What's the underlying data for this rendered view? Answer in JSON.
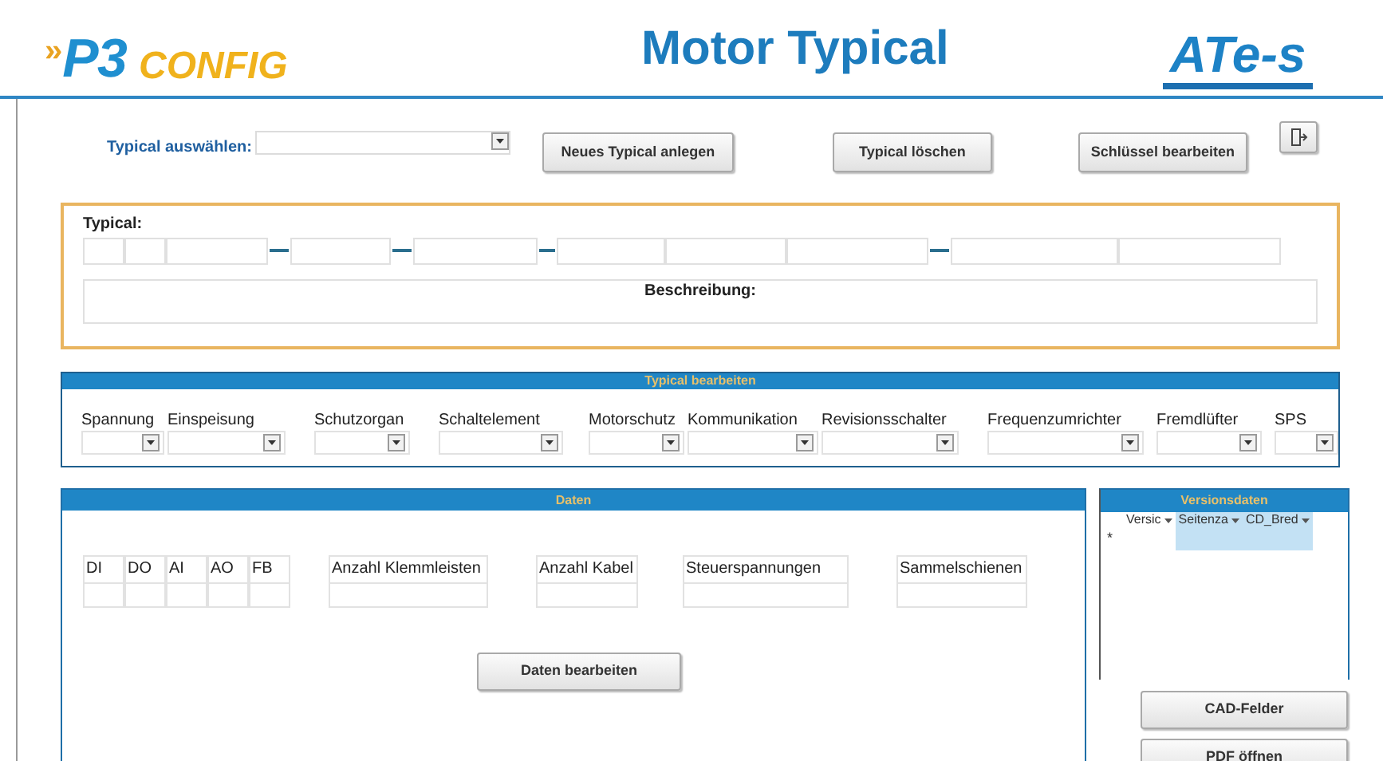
{
  "header": {
    "logo_mark": "»",
    "logo_main": "P3",
    "logo_sub": "CONFIG",
    "title": "Motor Typical",
    "brand": "ATe-s"
  },
  "toolbar": {
    "select_label": "Typical auswählen:",
    "buttons": [
      "Neues Typical anlegen",
      "Typical löschen",
      "Schlüssel bearbeiten"
    ]
  },
  "typical": {
    "label": "Typical:",
    "description_label": "Beschreibung:"
  },
  "typical_edit": {
    "title": "Typical bearbeiten",
    "fields": [
      {
        "label": "Spannung"
      },
      {
        "label": "Einspeisung"
      },
      {
        "label": "Schutzorgan"
      },
      {
        "label": "Schaltelement"
      },
      {
        "label": "Motorschutz"
      },
      {
        "label": "Kommunikation"
      },
      {
        "label": "Revisionsschalter"
      },
      {
        "label": "Frequenzumrichter"
      },
      {
        "label": "Fremdlüfter"
      },
      {
        "label": "SPS"
      }
    ]
  },
  "data": {
    "title": "Daten",
    "fields": [
      {
        "label": "DI"
      },
      {
        "label": "DO"
      },
      {
        "label": "AI"
      },
      {
        "label": "AO"
      },
      {
        "label": "FB"
      },
      {
        "label": "Anzahl Klemmleisten"
      },
      {
        "label": "Anzahl Kabel"
      },
      {
        "label": "Steuerspannungen"
      },
      {
        "label": "Sammelschienen"
      }
    ],
    "button": "Daten bearbeiten"
  },
  "versions": {
    "title": "Versionsdaten",
    "columns": [
      {
        "label": "Versic",
        "selected": false
      },
      {
        "label": "Seitenza",
        "selected": true
      },
      {
        "label": "CD_Bred",
        "selected": true
      }
    ],
    "new_row_marker": "*"
  },
  "side_buttons": [
    "CAD-Felder",
    "PDF öffnen"
  ]
}
